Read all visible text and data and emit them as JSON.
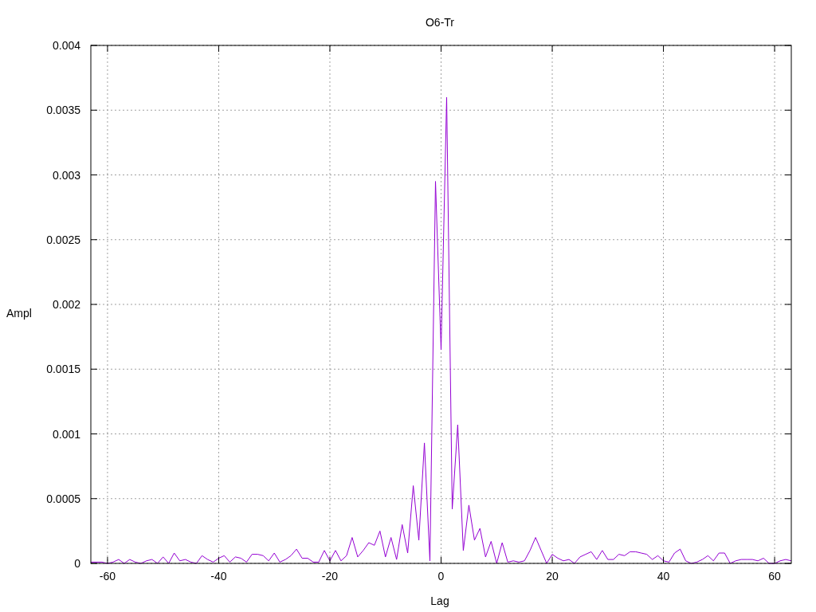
{
  "chart_data": {
    "type": "line",
    "title": "O6-Tr",
    "xlabel": "Lag",
    "ylabel": "Ampl",
    "x": [
      -63,
      -62,
      -61,
      -60,
      -59,
      -58,
      -57,
      -56,
      -55,
      -54,
      -53,
      -52,
      -51,
      -50,
      -49,
      -48,
      -47,
      -46,
      -45,
      -44,
      -43,
      -42,
      -41,
      -40,
      -39,
      -38,
      -37,
      -36,
      -35,
      -34,
      -33,
      -32,
      -31,
      -30,
      -29,
      -28,
      -27,
      -26,
      -25,
      -24,
      -23,
      -22,
      -21,
      -20,
      -19,
      -18,
      -17,
      -16,
      -15,
      -14,
      -13,
      -12,
      -11,
      -10,
      -9,
      -8,
      -7,
      -6,
      -5,
      -4,
      -3,
      -2,
      -1,
      0,
      1,
      2,
      3,
      4,
      5,
      6,
      7,
      8,
      9,
      10,
      11,
      12,
      13,
      14,
      15,
      16,
      17,
      18,
      19,
      20,
      21,
      22,
      23,
      24,
      25,
      26,
      27,
      28,
      29,
      30,
      31,
      32,
      33,
      34,
      35,
      36,
      37,
      38,
      39,
      40,
      41,
      42,
      43,
      44,
      45,
      46,
      47,
      48,
      49,
      50,
      51,
      52,
      53,
      54,
      55,
      56,
      57,
      58,
      59,
      60,
      61,
      62,
      63
    ],
    "grid": true,
    "series": [
      {
        "color": "#9400d3",
        "values": [
          1e-05,
          1e-05,
          1e-05,
          0,
          1e-05,
          3e-05,
          0,
          3e-05,
          1e-05,
          0,
          2e-05,
          3e-05,
          0,
          5e-05,
          0,
          8e-05,
          2e-05,
          3e-05,
          1e-05,
          0,
          6e-05,
          3e-05,
          1e-05,
          4e-05,
          6e-05,
          1e-05,
          5e-05,
          4e-05,
          1e-05,
          7e-05,
          7e-05,
          6e-05,
          2e-05,
          8e-05,
          1e-05,
          3e-05,
          6e-05,
          0.00011,
          4e-05,
          4e-05,
          1e-05,
          1e-05,
          0.0001,
          2e-05,
          0.0001,
          2e-05,
          6e-05,
          0.0002,
          5e-05,
          0.0001,
          0.00016,
          0.00014,
          0.00025,
          5e-05,
          0.0002,
          3e-05,
          0.0003,
          8e-05,
          0.0006,
          0.00018,
          0.00093,
          2e-05,
          0.00295,
          0.00165,
          0.0036,
          0.00042,
          0.00107,
          0.0001,
          0.00045,
          0.00018,
          0.00027,
          5e-05,
          0.00017,
          0,
          0.00016,
          1e-05,
          2e-05,
          1e-05,
          2e-05,
          0.0001,
          0.0002,
          0.0001,
          0,
          7e-05,
          4e-05,
          2e-05,
          3e-05,
          0,
          5e-05,
          7e-05,
          9e-05,
          3e-05,
          0.0001,
          3e-05,
          3e-05,
          7e-05,
          6e-05,
          9e-05,
          9e-05,
          8e-05,
          7e-05,
          3e-05,
          6e-05,
          2e-05,
          1e-05,
          8e-05,
          0.00011,
          2e-05,
          0,
          1e-05,
          3e-05,
          6e-05,
          2e-05,
          8e-05,
          8e-05,
          0,
          2e-05,
          3e-05,
          3e-05,
          3e-05,
          2e-05,
          4e-05,
          0,
          0,
          2e-05,
          3e-05,
          2e-05
        ]
      }
    ],
    "xlim": [
      -63,
      63
    ],
    "ylim": [
      0,
      0.004
    ],
    "xticks": [
      -60,
      -40,
      -20,
      0,
      20,
      40,
      60
    ],
    "yticks": [
      0,
      0.0005,
      0.001,
      0.0015,
      0.002,
      0.0025,
      0.003,
      0.0035,
      0.004
    ]
  }
}
